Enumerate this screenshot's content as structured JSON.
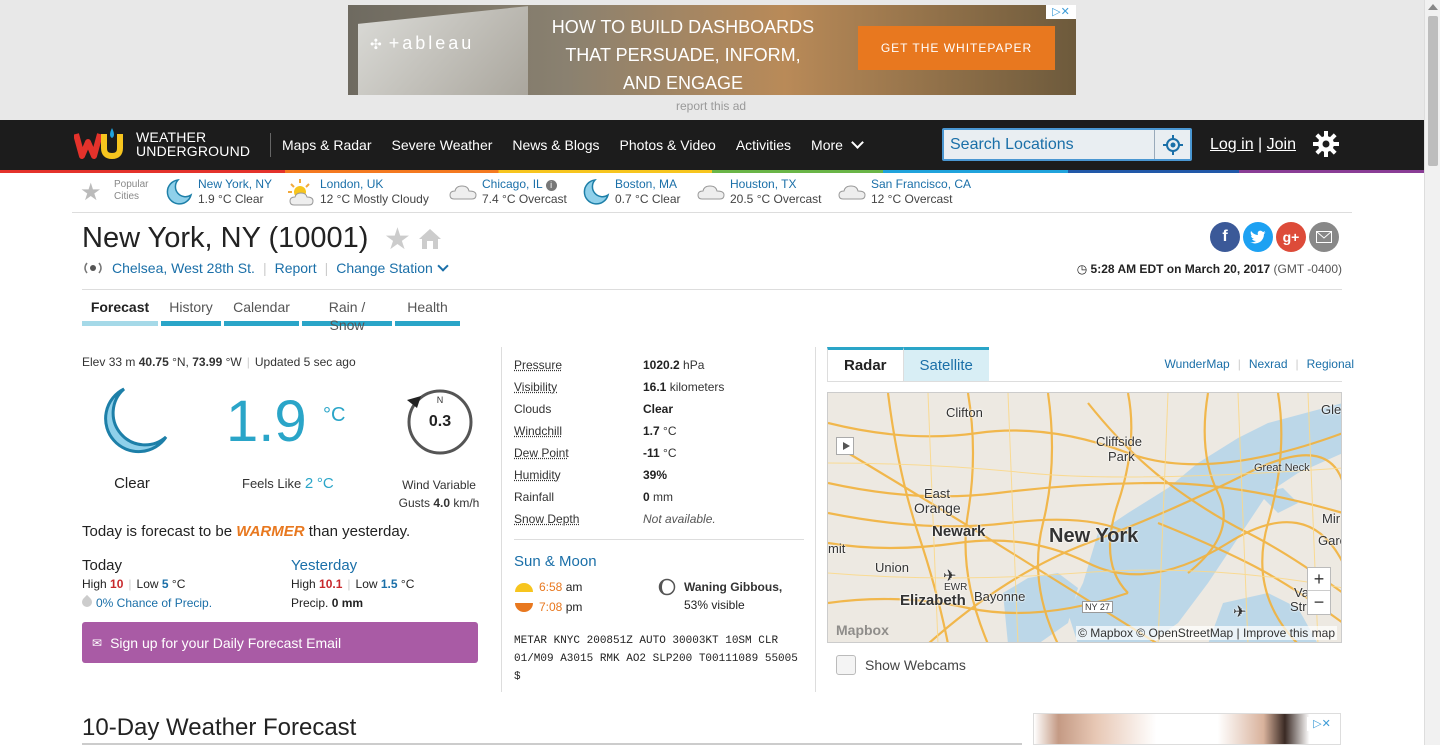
{
  "ad": {
    "logo": "+ableau",
    "headline_1": "HOW TO BUILD DASHBOARDS",
    "headline_2": "THAT PERSUADE, INFORM,",
    "headline_3": "AND ENGAGE",
    "cta": "GET THE WHITEPAPER",
    "report": "report this ad"
  },
  "nav": {
    "logo_line1": "WEATHER",
    "logo_line2": "UNDERGROUND",
    "items": [
      "Maps & Radar",
      "Severe Weather",
      "News & Blogs",
      "Photos & Video",
      "Activities",
      "More"
    ],
    "search_placeholder": "Search Locations",
    "login": "Log in",
    "join": "Join",
    "divider": "|"
  },
  "popular": {
    "label_1": "Popular",
    "label_2": "Cities",
    "cities": [
      {
        "name": "New York, NY",
        "cond": "1.9 °C Clear",
        "icon": "moon-icon"
      },
      {
        "name": "London, UK",
        "cond": "12 °C Mostly Cloudy",
        "icon": "partly-cloudy-icon"
      },
      {
        "name": "Chicago, IL",
        "cond": "7.4 °C Overcast",
        "icon": "cloud-icon"
      },
      {
        "name": "Boston, MA",
        "cond": "0.7 °C Clear",
        "icon": "moon-icon"
      },
      {
        "name": "Houston, TX",
        "cond": "20.5 °C Overcast",
        "icon": "cloud-icon"
      },
      {
        "name": "San Francisco, CA",
        "cond": "12 °C Overcast",
        "icon": "cloud-icon"
      }
    ]
  },
  "location": {
    "title": "New York, NY (10001)",
    "station": "Chelsea, West 28th St.",
    "report": "Report",
    "change_station": "Change Station",
    "time": "5:28 AM EDT",
    "on": "on",
    "date": "March 20, 2017",
    "gmt": "(GMT -0400)"
  },
  "tabs": [
    "Forecast",
    "History",
    "Calendar",
    "Rain / Snow",
    "Health"
  ],
  "current": {
    "elev_label": "Elev",
    "elev": "33 m",
    "lat": "40.75",
    "lat_suffix": "°N,",
    "lon": "73.99",
    "lon_suffix": "°W",
    "updated_label": "Updated",
    "updated": "5 sec ago",
    "condition": "Clear",
    "temp": "1.9",
    "unit": "°C",
    "feels_label": "Feels Like",
    "feels": "2",
    "feels_unit": "°C",
    "wind_dir": "N",
    "wind_speed": "0.3",
    "wind_label": "Wind Variable",
    "gusts_label": "Gusts",
    "gusts": "4.0",
    "gusts_unit": "km/h",
    "forecast_pre": "Today is forecast to be",
    "forecast_word": "WARMER",
    "forecast_post": "than yesterday."
  },
  "today": {
    "label": "Today",
    "high_label": "High",
    "high": "10",
    "low_label": "Low",
    "low": "5",
    "unit": "°C",
    "precip": "0% Chance of Precip."
  },
  "yesterday": {
    "label": "Yesterday",
    "high_label": "High",
    "high": "10.1",
    "low_label": "Low",
    "low": "1.5",
    "unit": "°C",
    "precip_label": "Precip.",
    "precip": "0 mm"
  },
  "signup": "Sign up for your Daily Forecast Email",
  "conditions": [
    {
      "key": "Pressure",
      "value": "1020.2",
      "unit": "hPa",
      "underline": true
    },
    {
      "key": "Visibility",
      "value": "16.1",
      "unit": "kilometers",
      "underline": true
    },
    {
      "key": "Clouds",
      "value": "Clear",
      "unit": "",
      "underline": false
    },
    {
      "key": "Windchill",
      "value": "1.7",
      "unit": "°C",
      "underline": true
    },
    {
      "key": "Dew Point",
      "value": "-11",
      "unit": "°C",
      "underline": true
    },
    {
      "key": "Humidity",
      "value": "39%",
      "unit": "",
      "underline": true
    },
    {
      "key": "Rainfall",
      "value": "0",
      "unit": "mm",
      "underline": false
    },
    {
      "key": "Snow Depth",
      "value": "",
      "unit": "Not available.",
      "underline": true
    }
  ],
  "sunmoon": {
    "title": "Sun & Moon",
    "sunrise_time": "6:58",
    "sunrise_ampm": "am",
    "sunset_time": "7:08",
    "sunset_ampm": "pm",
    "phase": "Waning Gibbous,",
    "visible": "53% visible"
  },
  "metar": {
    "line1": "METAR KNYC 200851Z AUTO 30003KT 10SM CLR",
    "line2": "01/M09 A3015 RMK AO2 SLP200 T00111089 55005",
    "line3": "$"
  },
  "map": {
    "tab_radar": "Radar",
    "tab_satellite": "Satellite",
    "links": [
      "WunderMap",
      "Nexrad",
      "Regional"
    ],
    "labels": {
      "clifton": "Clifton",
      "cliffside": "Cliffside",
      "park": "Park",
      "great_neck": "Great Neck",
      "gle": "Gle",
      "east": "East",
      "orange": "Orange",
      "newark": "Newark",
      "new_york": "New York",
      "mit": "mit",
      "union": "Union",
      "ewr": "EWR",
      "elizabeth": "Elizabeth",
      "bayonne": "Bayonne",
      "ny27": "NY 27",
      "mir": "Mir",
      "garc": "Garc",
      "vall": "Valle",
      "strea": "Strea"
    },
    "zoom_in": "+",
    "zoom_out": "−",
    "mapbox": "Mapbox",
    "attribution": "© Mapbox © OpenStreetMap | Improve this map",
    "webcams": "Show Webcams"
  },
  "tenday": "10-Day Weather Forecast",
  "colors": {
    "accent": "#2aa5c8",
    "link": "#1a6fa8",
    "signup": "#a95ba5",
    "orange": "#e8781f",
    "nav": "#1c1c1c"
  }
}
